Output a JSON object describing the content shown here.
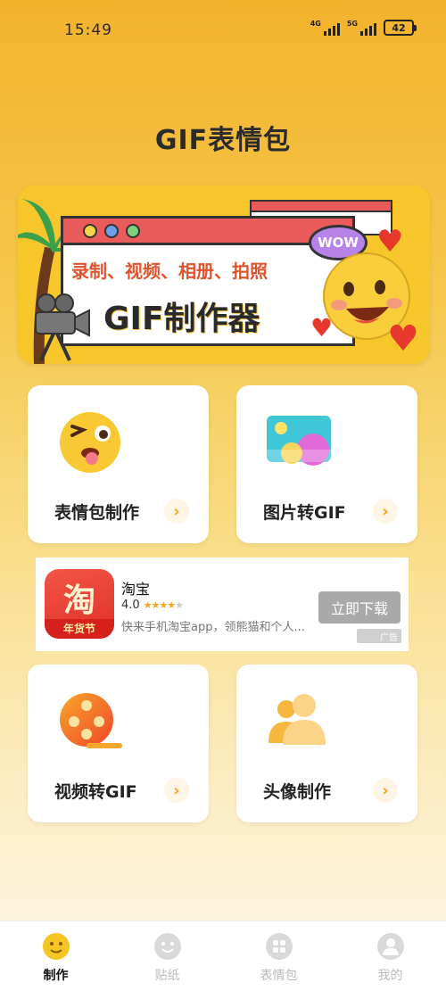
{
  "status_bar": {
    "time": "15:49",
    "signal1_label": "4G",
    "signal2_label": "5G",
    "battery": "42"
  },
  "app_title": "GIF表情包",
  "banner": {
    "subtitle": "录制、视频、相册、拍照",
    "title": "GIF制作器",
    "bubble_text": "WOW"
  },
  "cards": [
    {
      "label": "表情包制作",
      "icon": "winking-face-icon"
    },
    {
      "label": "图片转GIF",
      "icon": "image-icon"
    },
    {
      "label": "视频转GIF",
      "icon": "film-reel-icon"
    },
    {
      "label": "头像制作",
      "icon": "users-icon"
    }
  ],
  "ad": {
    "icon_text": "淘",
    "icon_subtext": "年货节",
    "app_name": "淘宝",
    "rating": "4.0",
    "stars_on": 4,
    "description": "快来手机淘宝app，领熊猫和个人...",
    "button_label": "立即下载",
    "ad_tag": "广告"
  },
  "nav": [
    {
      "label": "制作",
      "active": true
    },
    {
      "label": "贴纸",
      "active": false
    },
    {
      "label": "表情包",
      "active": false
    },
    {
      "label": "我的",
      "active": false
    }
  ],
  "colors": {
    "accent": "#f5c623",
    "arrow": "#f0a419",
    "banner_red": "#ea5b5b"
  }
}
